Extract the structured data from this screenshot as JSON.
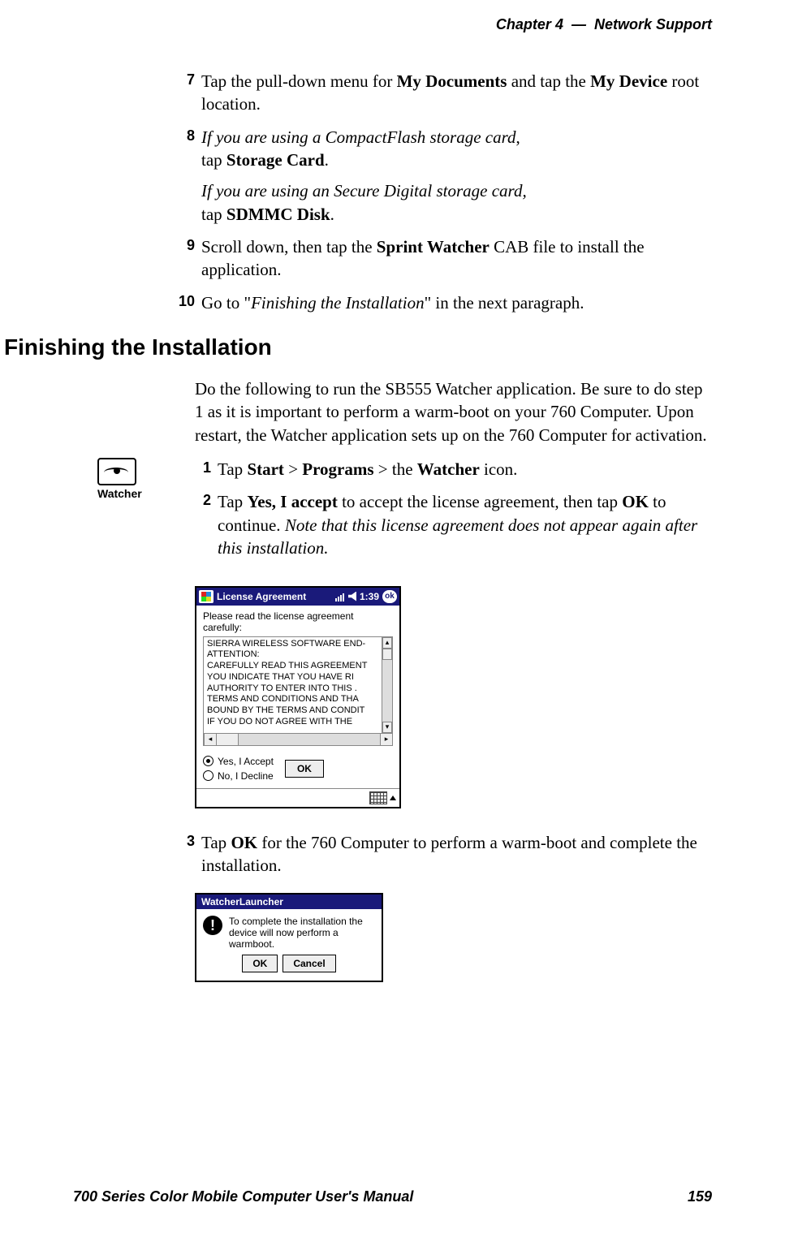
{
  "header": {
    "chapter_label": "Chapter",
    "chapter_num": "4",
    "dash": "—",
    "chapter_title": "Network Support"
  },
  "steps_a": {
    "n7": "7",
    "s7_a": "Tap the pull-down menu for ",
    "s7_b": "My Documents",
    "s7_c": " and tap the ",
    "s7_d": "My Device",
    "s7_e": " root location.",
    "n8": "8",
    "s8_a": "If you are using a CompactFlash storage card",
    "s8_b": ",",
    "s8_c": "tap ",
    "s8_d": "Storage Card",
    "s8_e": ".",
    "s8_f": "If you are using an Secure Digital storage card,",
    "s8_g": "tap ",
    "s8_h": "SDMMC Disk",
    "s8_i": ".",
    "n9": "9",
    "s9_a": "Scroll down, then tap the ",
    "s9_b": "Sprint Watcher",
    "s9_c": " CAB file to install the application.",
    "n10": "10",
    "s10_a": "Go to \"",
    "s10_b": "Finishing the Installation",
    "s10_c": "\" in the next paragraph."
  },
  "section_heading": "Finishing the Installation",
  "intro_para": "Do the following to run the SB555 Watcher application. Be sure to do step 1 as it is important to perform a warm-boot on your 760 Computer. Upon restart, the Watcher application sets up on the 760 Computer for activation.",
  "watcher_icon_label": "Watcher",
  "steps_b": {
    "n1": "1",
    "s1_a": "Tap ",
    "s1_b": "Start",
    "s1_c": " > ",
    "s1_d": "Programs",
    "s1_e": " > the ",
    "s1_f": "Watcher",
    "s1_g": " icon.",
    "n2": "2",
    "s2_a": "Tap ",
    "s2_b": "Yes, I accept",
    "s2_c": " to accept the license agreement, then tap ",
    "s2_d": "OK",
    "s2_e": " to continue. ",
    "s2_f": "Note that this license agreement does not appear again after this installation."
  },
  "license_dialog": {
    "title": "License Agreement",
    "time": "1:39",
    "ok_badge": "ok",
    "prompt": "Please read the license agreement carefully:",
    "lines": [
      "SIERRA WIRELESS SOFTWARE END-",
      "ATTENTION:",
      "CAREFULLY READ THIS AGREEMENT",
      "YOU  INDICATE THAT YOU HAVE RI",
      "AUTHORITY TO ENTER INTO THIS .",
      "TERMS AND CONDITIONS AND THA",
      "BOUND BY THE TERMS AND CONDIT",
      "IF YOU DO NOT AGREE WITH THE "
    ],
    "radio_yes": "Yes, I Accept",
    "radio_no": "No, I Decline",
    "ok_button": "OK"
  },
  "steps_c": {
    "n3": "3",
    "s3_a": "Tap ",
    "s3_b": "OK",
    "s3_c": " for the 760 Computer to perform a warm-boot and complete the installation."
  },
  "launcher_dialog": {
    "title": "WatcherLauncher",
    "message": "To complete the installation the device will now perform a warmboot.",
    "ok": "OK",
    "cancel": "Cancel",
    "excl": "!"
  },
  "footer": {
    "manual": "700 Series Color Mobile Computer User's Manual",
    "page": "159"
  }
}
